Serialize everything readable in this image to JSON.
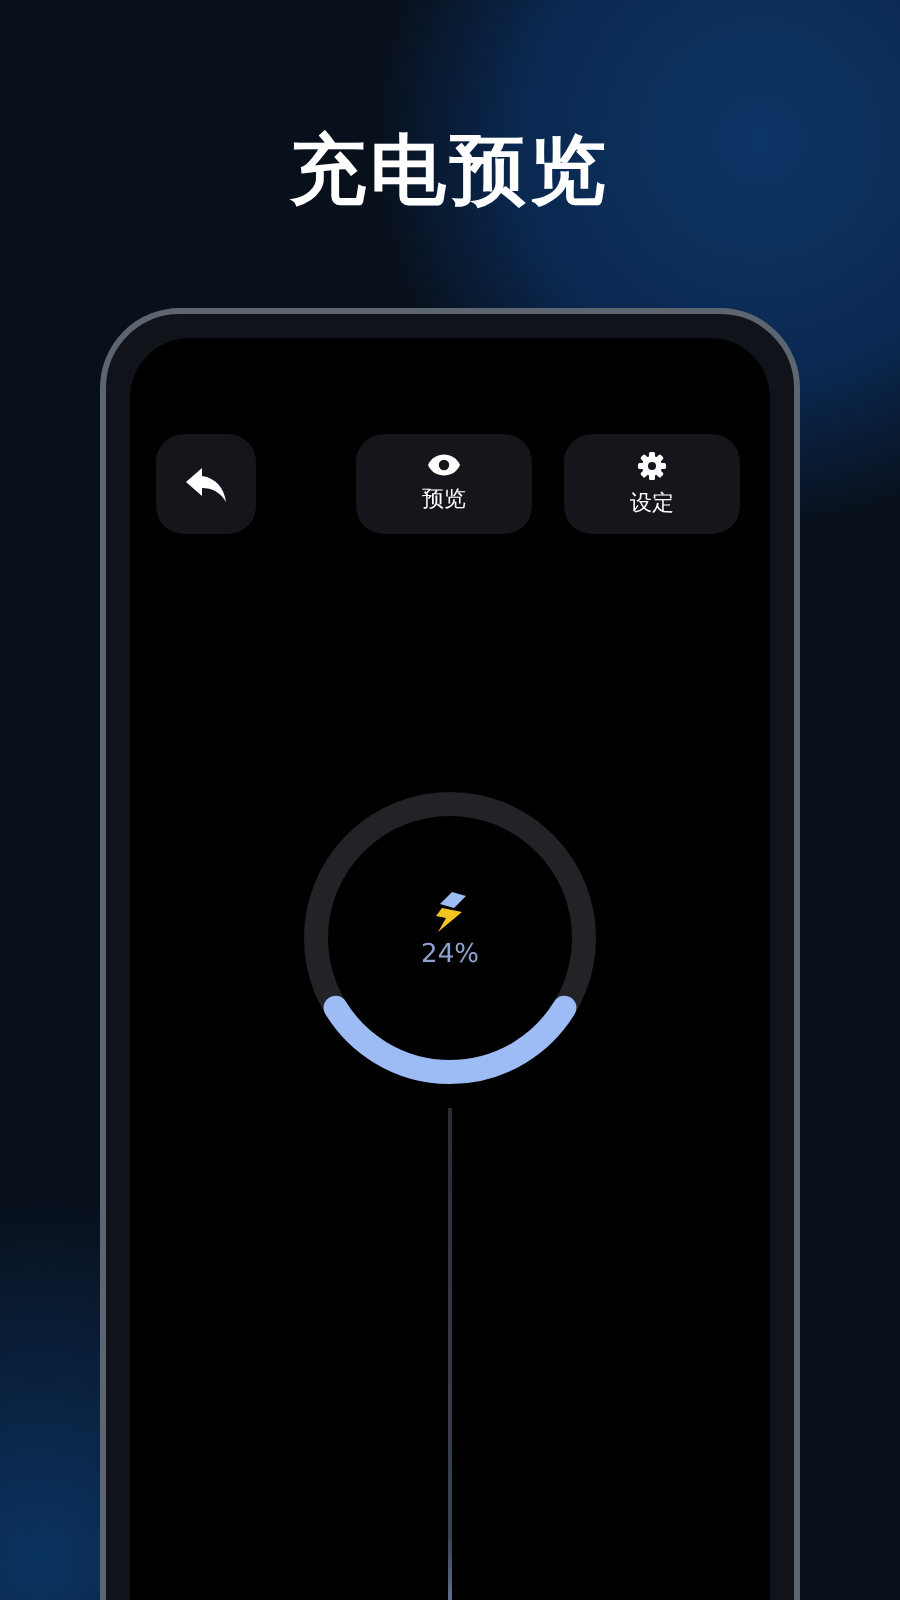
{
  "title": "充电预览",
  "toolbar": {
    "buttons": [
      {
        "kind": "back"
      },
      {
        "kind": "preview",
        "label": "预览"
      },
      {
        "kind": "settings",
        "label": "设定"
      }
    ]
  },
  "battery": {
    "reading": "24%"
  }
}
